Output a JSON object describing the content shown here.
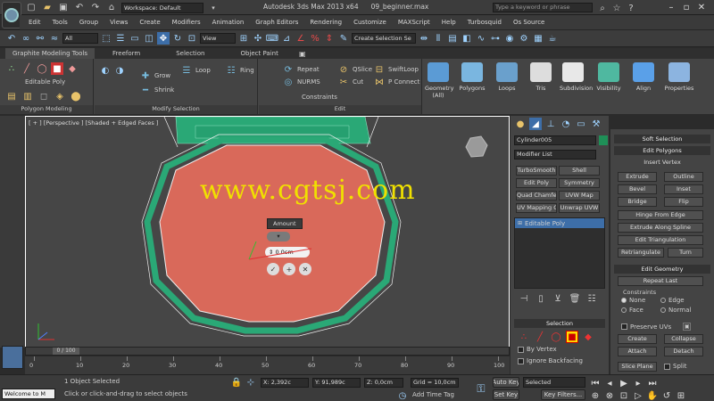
{
  "window": {
    "workspace_label": "Workspace: Default",
    "app_title": "Autodesk 3ds Max  2013 x64",
    "file_name": "09_beginner.max",
    "search_placeholder": "Type a keyword or phrase"
  },
  "menu": [
    "Edit",
    "Tools",
    "Group",
    "Views",
    "Create",
    "Modifiers",
    "Animation",
    "Graph Editors",
    "Rendering",
    "Customize",
    "MAXScript",
    "Help",
    "Turbosquid",
    "Os Source"
  ],
  "main_toolbar": {
    "filter_dropdown": "All",
    "ref_coord_dropdown": "View",
    "selection_set": "Create Selection Se"
  },
  "ribbon": {
    "tabs": [
      "Graphite Modeling Tools",
      "Freeform",
      "Selection",
      "Object Paint"
    ],
    "polygon_modeling": {
      "label": "Polygon Modeling",
      "editable_poly": "Editable Poly"
    },
    "modify_selection": {
      "label": "Modify Selection",
      "grow": "Grow",
      "shrink": "Shrink",
      "loop": "Loop",
      "ring": "Ring"
    },
    "edit": {
      "label": "Edit",
      "repeat": "Repeat",
      "nurms": "NURMS",
      "constraints": "Constraints",
      "qslice": "QSlice",
      "cut": "Cut",
      "swiftloop": "SwiftLoop",
      "p_connect": "P Connect"
    },
    "big_buttons": [
      "Geometry (All)",
      "Polygons",
      "Loops",
      "Tris",
      "Subdivision",
      "Visibility",
      "Align",
      "Properties"
    ]
  },
  "viewport": {
    "label": "[ + ] [Perspective ] [Shaded + Edged Faces ]",
    "watermark": "www.cgtsj.com",
    "caddy_title": "Amount",
    "caddy_value": "0.0cm"
  },
  "command_panel": {
    "object_name": "Cylinder005",
    "color": "#1f8f57",
    "modifier_list": "Modifier List",
    "buttons": [
      "TurboSmooth",
      "Shell",
      "Edit Poly",
      "Symmetry",
      "Quad Chamfer",
      "UVW Map",
      "UV Mapping Cle",
      "Unwrap UVW"
    ],
    "stack_item": "Editable Poly",
    "selection_head": "Selection",
    "by_vertex": "By Vertex",
    "ignore_backfacing": "Ignore Backfacing"
  },
  "modify_panel": {
    "soft_selection": "Soft Selection",
    "edit_polygons": "Edit Polygons",
    "insert_vertex": "Insert Vertex",
    "rows": [
      [
        "Extrude",
        "Outline"
      ],
      [
        "Bevel",
        "Inset"
      ],
      [
        "Bridge",
        "Flip"
      ]
    ],
    "hinge": "Hinge From Edge",
    "extrude_along_spline": "Extrude Along Spline",
    "edit_triangulation": "Edit Triangulation",
    "retriangulate": "Retriangulate",
    "turn": "Turn",
    "edit_geometry": "Edit Geometry",
    "repeat_last": "Repeat Last",
    "constraints_label": "Constraints",
    "constraint_options": [
      "None",
      "Edge",
      "Face",
      "Normal"
    ],
    "preserve_uvs": "Preserve UVs",
    "create": "Create",
    "collapse": "Collapse",
    "attach": "Attach",
    "detach": "Detach",
    "slice_plane": "Slice Plane",
    "split": "Split"
  },
  "timeline": {
    "frame": "0 / 100",
    "ticks": [
      "0",
      "10",
      "20",
      "30",
      "40",
      "50",
      "60",
      "70",
      "80",
      "90",
      "100"
    ]
  },
  "status": {
    "welcome": "Welcome to M",
    "objects_selected": "1 Object Selected",
    "prompt": "Click or click-and-drag to select objects",
    "x": "X: 2,392с",
    "y": "Y: 91,989с",
    "z": "Z: 0,0cm",
    "grid": "Grid = 10,0cm",
    "add_time_tag": "Add Time Tag",
    "auto_key": "Auto Key",
    "selected": "Selected",
    "set_key": "Set Key",
    "key_filters": "Key Filters..."
  }
}
